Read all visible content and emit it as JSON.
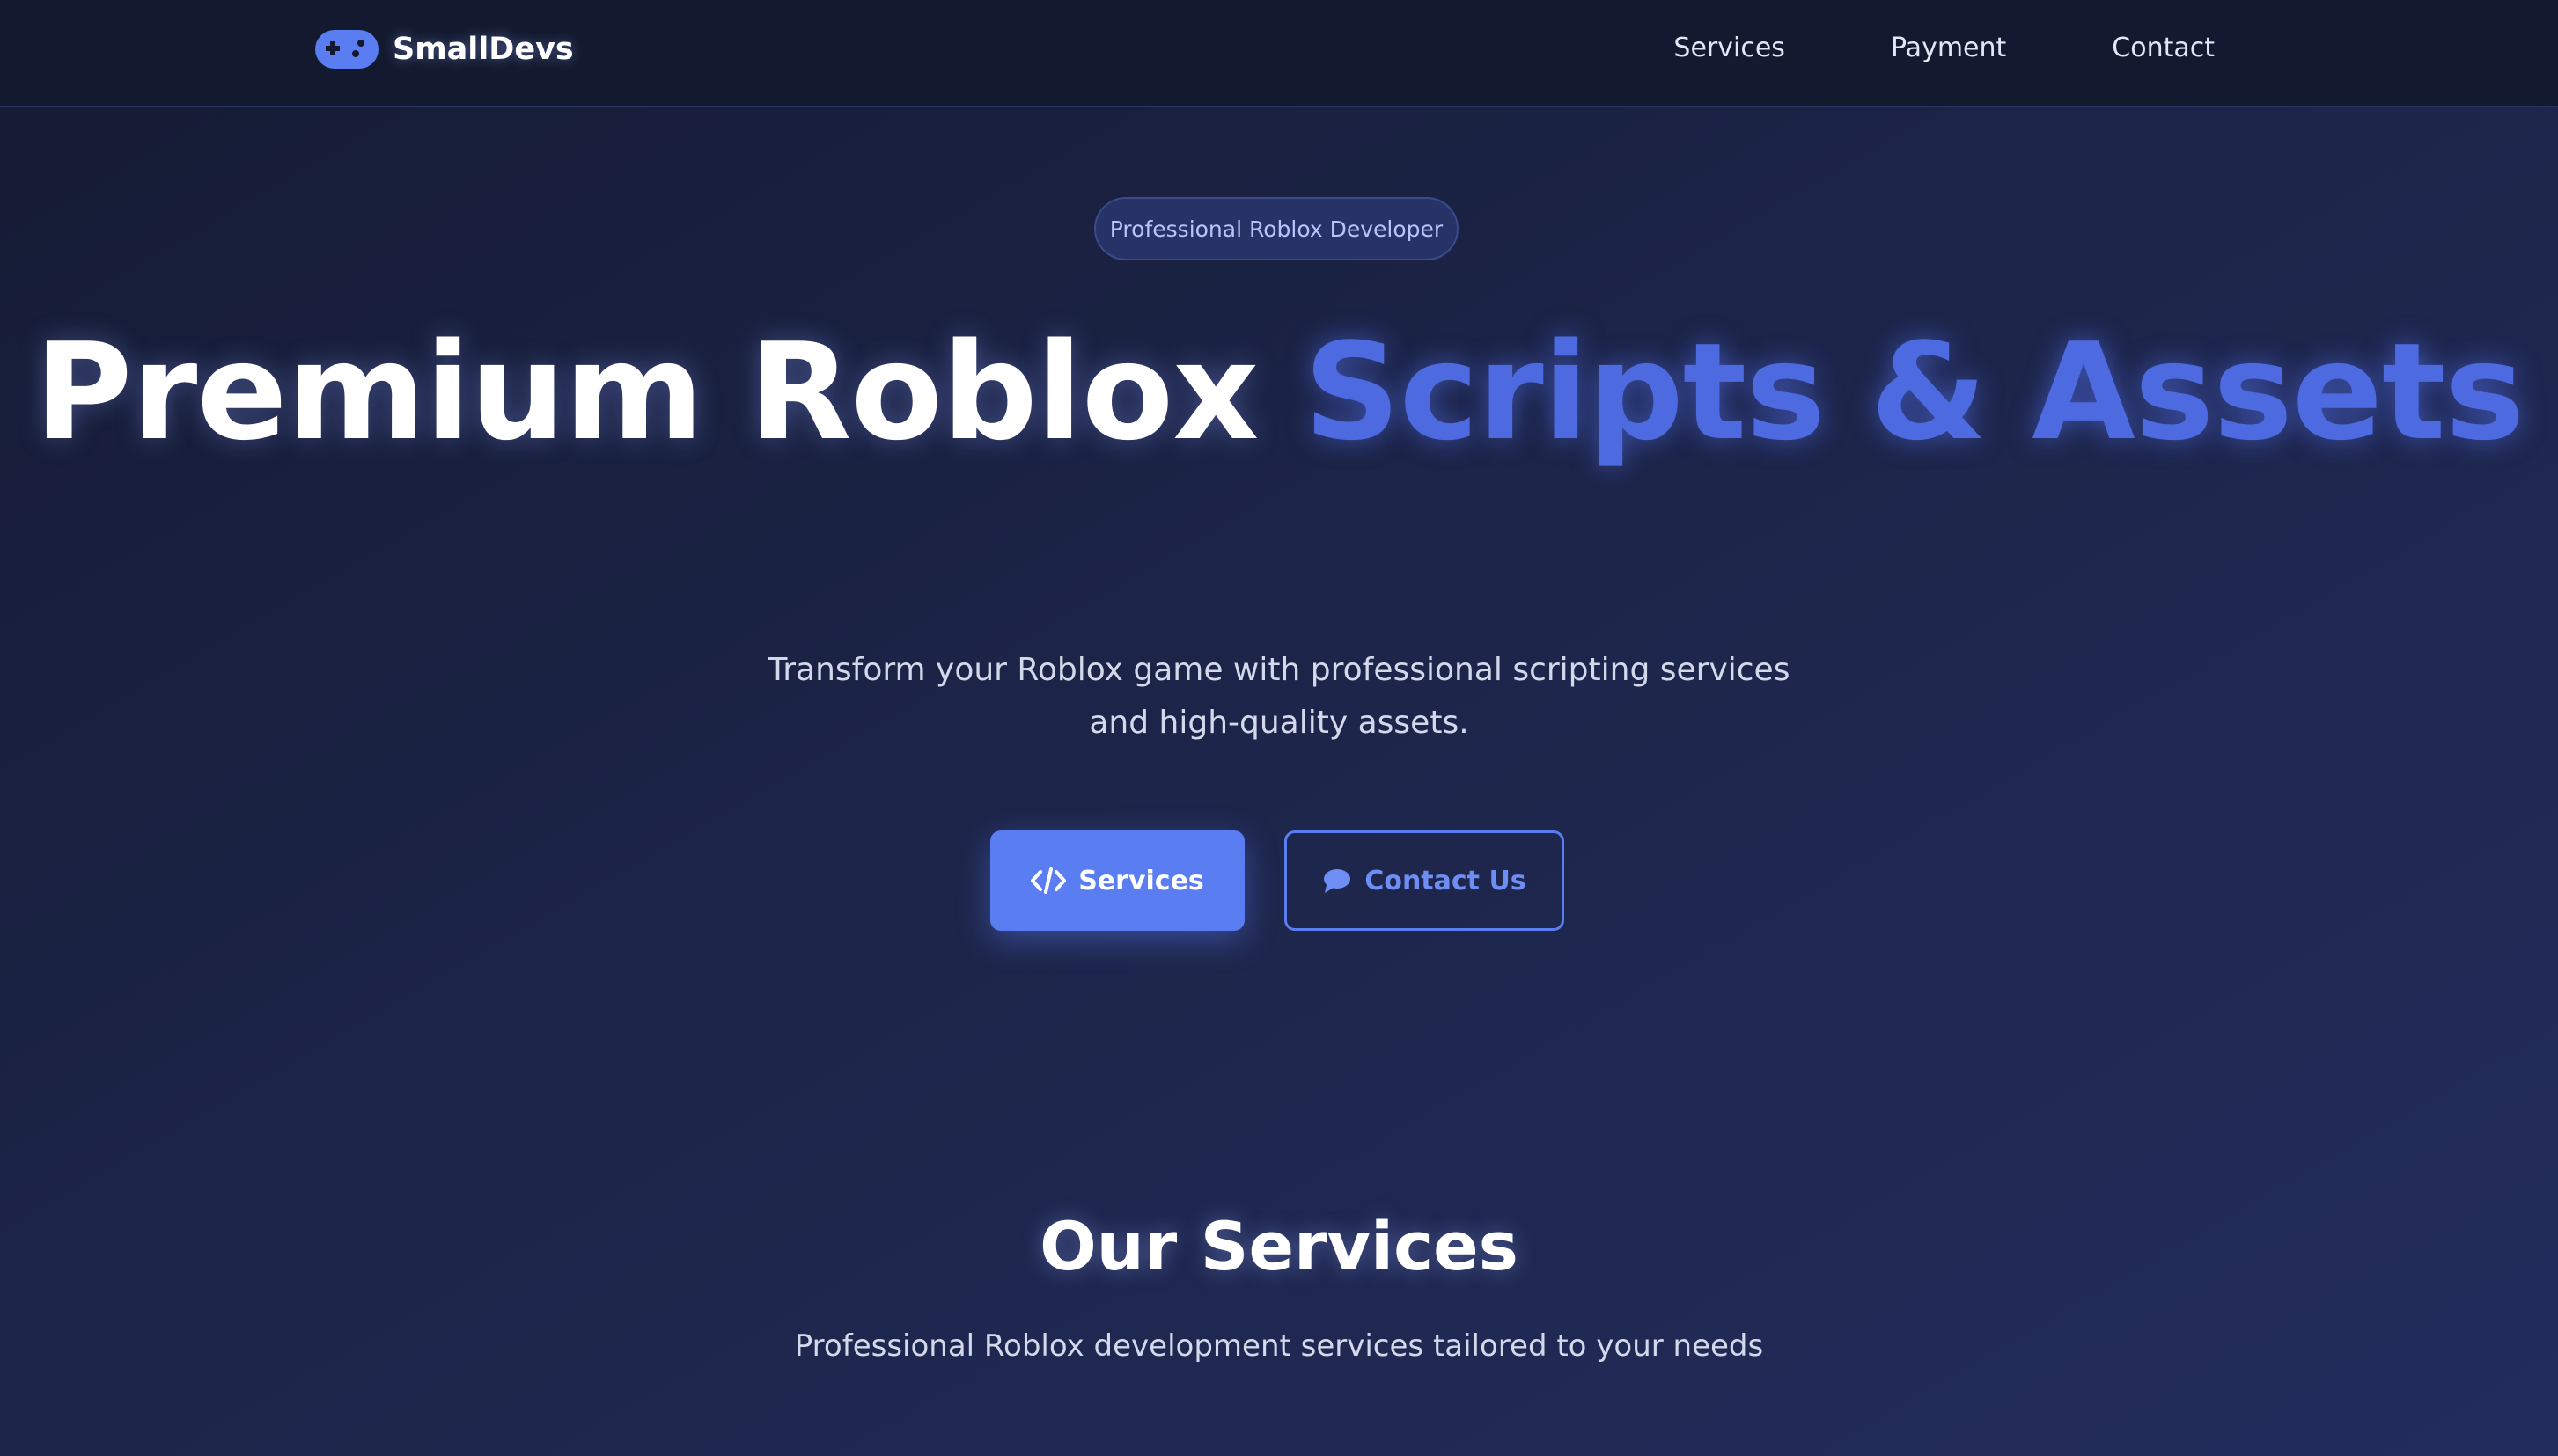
{
  "nav": {
    "brand": "SmallDevs",
    "brand_icon": "gamepad-icon",
    "links": [
      "Services",
      "Payment",
      "Contact"
    ]
  },
  "hero": {
    "badge": "Professional Roblox Developer",
    "title_main": "Premium Roblox ",
    "title_accent": "Scripts & Assets",
    "subtitle": "Transform your Roblox game with professional scripting services and high-quality assets.",
    "primary_button": {
      "label": "Services",
      "icon": "code-icon"
    },
    "secondary_button": {
      "label": "Contact Us",
      "icon": "chat-bubble-icon"
    }
  },
  "services": {
    "title": "Our Services",
    "subtitle": "Professional Roblox development services tailored to your needs"
  },
  "colors": {
    "accent": "#5b7df2",
    "accent_text": "#4e6ae0",
    "nav_bg": "#131a2f",
    "page_bg": "#1c2448"
  }
}
